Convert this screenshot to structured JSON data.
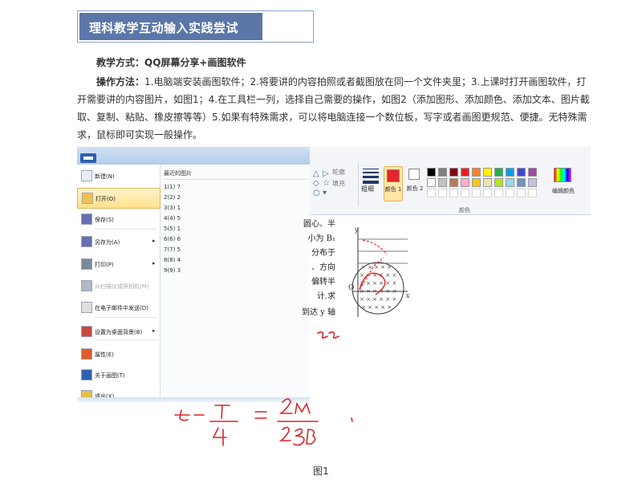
{
  "header": {
    "title": "理科教学互动输入实践尝试"
  },
  "intro": {
    "method_label": "教学方式：",
    "method_value": "QQ屏幕分享+画图软件",
    "steps_label": "操作方法：",
    "steps_text": "1.电脑端安装画图软件；2.将要讲的内容拍照或者截图放在同一个文件夹里；3.上课时打开画图软件，打开需要讲的内容图片，如图1；4.在工具栏一列，选择自己需要的操作，如图2（添加图形、添加颜色、添加文本、图片截取、复制、粘贴、橡皮擦等等）5.如果有特殊需求，可以将电脑连接一个数位板，写字或者画图更规范、便捷。无特殊需求，鼠标即可实现一般操作。"
  },
  "paint": {
    "menu": {
      "items": [
        {
          "label": "新建(N)",
          "icon": "new-file-icon"
        },
        {
          "label": "打开(O)",
          "icon": "open-folder-icon"
        },
        {
          "label": "保存(S)",
          "icon": "save-icon"
        },
        {
          "label": "另存为(A)",
          "icon": "save-as-icon"
        },
        {
          "label": "打印(P)",
          "icon": "print-icon"
        },
        {
          "label": "从扫描仪或照相机(M)",
          "icon": "scanner-icon"
        },
        {
          "label": "在电子邮件中发送(D)",
          "icon": "email-icon"
        },
        {
          "label": "设置为桌面背景(B)",
          "icon": "desktop-background-icon"
        },
        {
          "label": "属性(E)",
          "icon": "checkmark-icon"
        },
        {
          "label": "关于画图(T)",
          "icon": "info-icon"
        },
        {
          "label": "退出(X)",
          "icon": "exit-icon"
        }
      ],
      "recent_header": "最近的图片",
      "recent": [
        "1(1)  7",
        "2(2)  2",
        "3(3)  1",
        "4(4)  5",
        "5(5)  1",
        "6(6)  6",
        "7(7)  5",
        "8(8)  4",
        "9(9)  3"
      ]
    },
    "ribbon": {
      "outline": "轮廓",
      "fill": "填充",
      "thickness": "粗细",
      "color1": "颜色 1",
      "color2": "颜色 2",
      "edit_colors": "编辑颜色",
      "group_colors": "颜色",
      "palette": [
        "#000000",
        "#7f7f7f",
        "#880015",
        "#ed1c24",
        "#ff7f27",
        "#fff200",
        "#22b14c",
        "#00a2e8",
        "#3f48cc",
        "#a349a4",
        "#ffffff",
        "#c3c3c3",
        "#b97a57",
        "#ffaec9",
        "#ffc90e",
        "#efe4b0",
        "#b5e61d",
        "#99d9ea",
        "#7092be",
        "#c8bfe7",
        "#ffffff",
        "#ffffff",
        "#ffffff",
        "#ffffff",
        "#ffffff",
        "#ffffff",
        "#ffffff",
        "#ffffff",
        "#ffffff",
        "#ffffff"
      ]
    },
    "scan": {
      "lines": [
        "圆心、半",
        "小为 B₁",
        "分布于",
        "、方向",
        "偏转半",
        "计.求",
        "到达 y 轴"
      ],
      "axis_y": "y",
      "axis_x": "x",
      "origin": "O"
    }
  },
  "caption": "图1"
}
